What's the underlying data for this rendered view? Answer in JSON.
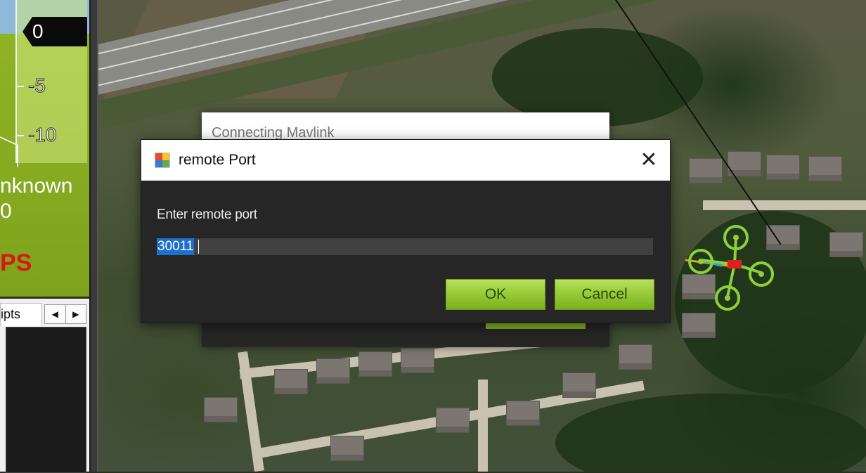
{
  "hud": {
    "altitude_value": "0",
    "tape_labels": [
      "-5",
      "-10"
    ],
    "status_lines": [
      "nknown",
      "0"
    ],
    "gps_text": "PS"
  },
  "left_panel": {
    "tab_label": "ripts",
    "scroll_left": "◀",
    "scroll_right": "▶"
  },
  "background_dialog": {
    "title": "Connecting Mavlink"
  },
  "dialog": {
    "title": "remote Port",
    "prompt": "Enter remote port",
    "input_value": "30011",
    "ok_label": "OK",
    "cancel_label": "Cancel",
    "close_glyph": "✕"
  },
  "colors": {
    "accent_green": "#9acb3a",
    "dialog_bg": "#262626",
    "selection_blue": "#1f6fd1",
    "gps_red": "#d81616"
  },
  "icons": {
    "dialog_icon": "app-window-icon",
    "close": "close-icon",
    "drone": "quadcopter-icon"
  }
}
